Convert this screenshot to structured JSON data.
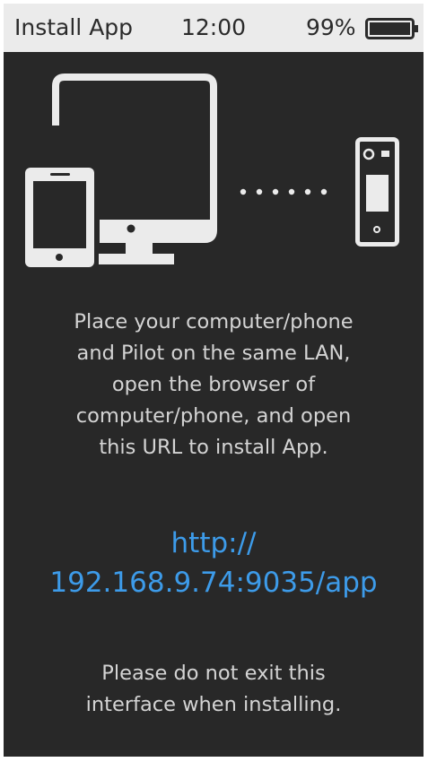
{
  "status_bar": {
    "title": "Install App",
    "time": "12:00",
    "battery": "99%"
  },
  "illustration": {
    "icons": [
      "tablet-icon",
      "monitor-icon",
      "pilot-device-icon"
    ]
  },
  "instructions": {
    "lines": [
      "Place your computer/phone",
      "and Pilot on the same LAN,",
      "open the browser of",
      "computer/phone, and open",
      "this URL to install App."
    ]
  },
  "url": {
    "line1": "http://",
    "line2": "192.168.9.74:9035/app"
  },
  "warning": {
    "lines": [
      "Please do not exit this",
      "interface when installing."
    ]
  },
  "colors": {
    "background": "#282828",
    "status_bar": "#ebebeb",
    "text": "#d4d4d4",
    "url": "#3d9be9",
    "icon": "#ebebeb"
  }
}
